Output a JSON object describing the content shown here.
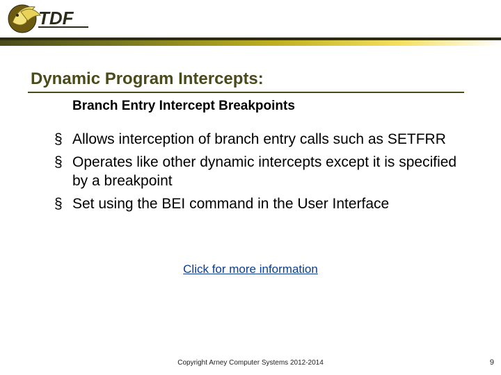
{
  "logo": {
    "text": "TDF"
  },
  "title": "Dynamic Program Intercepts:",
  "subtitle": "Branch Entry Intercept  Breakpoints",
  "bullets": [
    "Allows interception of branch entry calls such as SETFRR",
    "Operates like other dynamic intercepts except it is specified by a breakpoint",
    "Set using the BEI command in the User Interface"
  ],
  "more_info": {
    "label": "Click for more information"
  },
  "footer": {
    "copyright": "Copyright Arney Computer Systems 2012-2014"
  },
  "page_number": "9"
}
